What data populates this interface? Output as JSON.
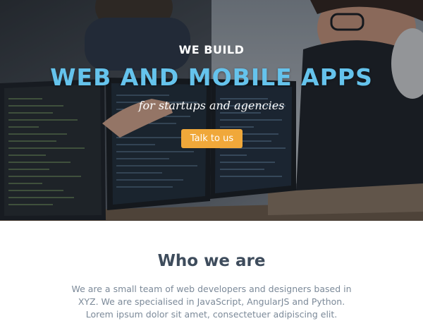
{
  "hero": {
    "eyebrow": "WE BUILD",
    "headline": "WEB AND MOBILE APPS",
    "tagline": "for startups and agencies",
    "cta_label": "Talk to us",
    "headline_color": "#65c3ec",
    "cta_color": "#f0a83a"
  },
  "about": {
    "title": "Who we are",
    "text": "We are a small team of web developers and designers based in XYZ. We are specialised in JavaScript, AngularJS and Python. Lorem ipsum dolor sit amet, consectetuer adipiscing elit."
  }
}
